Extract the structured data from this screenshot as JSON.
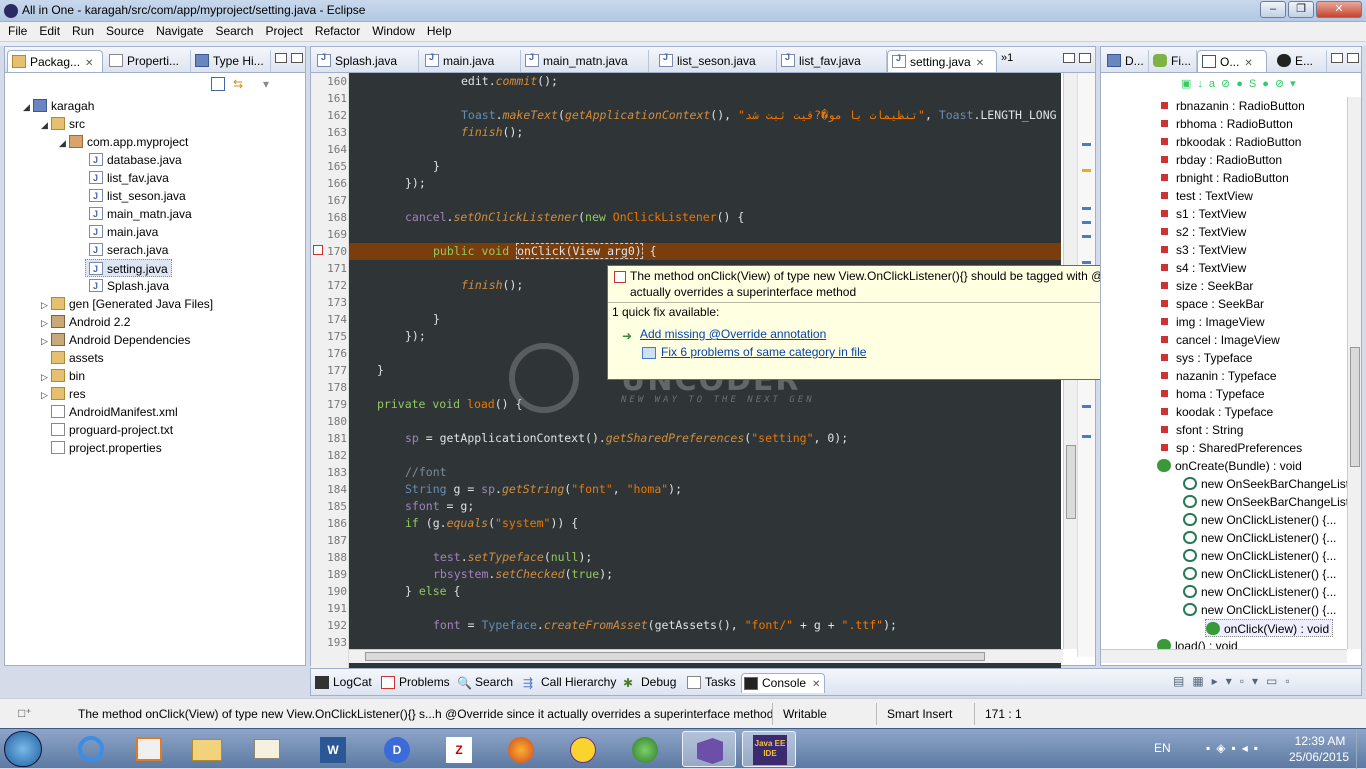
{
  "window": {
    "title": "All in One - karagah/src/com/app/myproject/setting.java - Eclipse"
  },
  "menu": [
    "File",
    "Edit",
    "Run",
    "Source",
    "Navigate",
    "Search",
    "Project",
    "Refactor",
    "Window",
    "Help"
  ],
  "left_tabs": {
    "package": "Packag...",
    "properties": "Properti...",
    "type": "Type Hi..."
  },
  "tree": {
    "project": "karagah",
    "src": "src",
    "package": "com.app.myproject",
    "files": [
      "database.java",
      "list_fav.java",
      "list_seson.java",
      "main_matn.java",
      "main.java",
      "serach.java",
      "setting.java",
      "Splash.java"
    ],
    "others": [
      "gen [Generated Java Files]",
      "Android 2.2",
      "Android Dependencies",
      "assets",
      "bin",
      "res",
      "AndroidManifest.xml",
      "proguard-project.txt",
      "project.properties"
    ]
  },
  "editor_tabs": [
    "Splash.java",
    "main.java",
    "main_matn.java",
    "list_seson.java",
    "list_fav.java",
    "setting.java"
  ],
  "editor_overflow": "1",
  "line_numbers": [
    "160",
    "161",
    "162",
    "163",
    "164",
    "165",
    "166",
    "167",
    "168",
    "169",
    "170",
    "171",
    "172",
    "173",
    "174",
    "175",
    "176",
    "177",
    "178",
    "179",
    "180",
    "181",
    "182",
    "183",
    "184",
    "185",
    "186",
    "187",
    "188",
    "189",
    "190",
    "191",
    "192",
    "193"
  ],
  "hover": {
    "message": "The method onClick(View) of type new View.OnClickListener(){} should be tagged with @Override since it actually overrides a superinterface method",
    "quickfix_title": "1 quick fix available:",
    "fix1": "Add missing @Override annotation",
    "fix2": "Fix 6 problems of same category in file"
  },
  "watermark": {
    "name": "UNCODER",
    "tagline": "NEW WAY TO THE NEXT GEN"
  },
  "right_tabs": {
    "d": "D...",
    "fi": "Fi...",
    "o": "O...",
    "e": "E..."
  },
  "outline": [
    "rbnazanin : RadioButton",
    "rbhoma : RadioButton",
    "rbkoodak : RadioButton",
    "rbday : RadioButton",
    "rbnight : RadioButton",
    "test : TextView",
    "s1 : TextView",
    "s2 : TextView",
    "s3 : TextView",
    "s4 : TextView",
    "size : SeekBar",
    "space : SeekBar",
    "img : ImageView",
    "cancel : ImageView",
    "sys : Typeface",
    "nazanin : Typeface",
    "homa : Typeface",
    "koodak : Typeface",
    "sfont : String",
    "sp : SharedPreferences",
    "onCreate(Bundle) : void",
    "new OnSeekBarChangeListener",
    "new OnSeekBarChangeListener",
    "new OnClickListener() {...",
    "new OnClickListener() {...",
    "new OnClickListener() {...",
    "new OnClickListener() {...",
    "new OnClickListener() {...",
    "new OnClickListener() {...",
    "onClick(View) : void",
    "load() : void"
  ],
  "bottom_tabs": [
    "LogCat",
    "Problems",
    "Search",
    "Call Hierarchy",
    "Debug",
    "Tasks",
    "Console"
  ],
  "status": {
    "message": "The method onClick(View) of type new View.OnClickListener(){} s...h @Override since it actually overrides a superinterface method",
    "writable": "Writable",
    "insert": "Smart Insert",
    "position": "171 : 1"
  },
  "taskbar": {
    "lang": "EN",
    "time": "12:39 AM",
    "date": "25/06/2015",
    "javaee": "Java EE IDE"
  }
}
